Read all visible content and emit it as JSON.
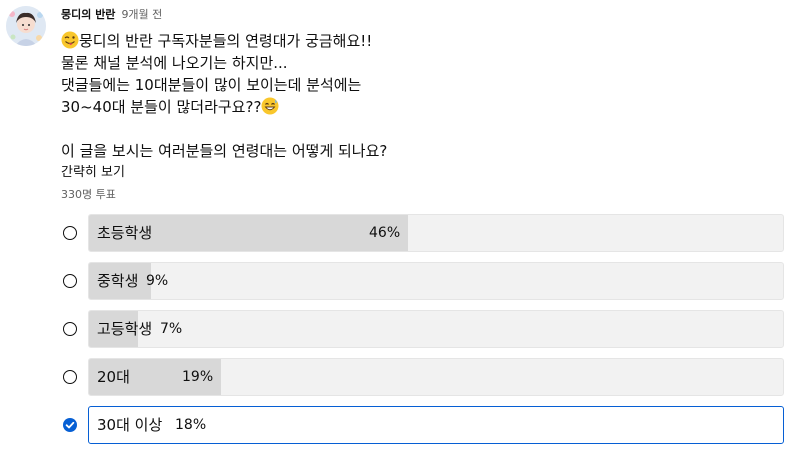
{
  "post": {
    "author": "뭉디의 반란",
    "time": "9개월 전",
    "line1": "뭉디의 반란 구독자분들의 연령대가 궁금해요!!",
    "line2": "물론 채널 분석에 나오기는 하지만...",
    "line3": "댓글들에는 10대분들이 많이 보이는데 분석에는",
    "line4": "30~40대 분들이 많더라구요??",
    "line5": "",
    "line6": "이 글을 보시는 여러분들의 연령대는 어떻게 되나요?",
    "read_more": "간략히 보기",
    "emoji_start": "winking-face-tongue-emoji",
    "emoji_end": "grinning-sweat-emoji"
  },
  "poll": {
    "vote_count": "330명 투표",
    "options": [
      {
        "label": "초등학생",
        "percent_text": "46%",
        "percent": 46,
        "selected": false
      },
      {
        "label": "중학생",
        "percent_text": "9%",
        "percent": 9,
        "selected": false
      },
      {
        "label": "고등학생",
        "percent_text": "7%",
        "percent": 7,
        "selected": false
      },
      {
        "label": "20대",
        "percent_text": "19%",
        "percent": 19,
        "selected": false
      },
      {
        "label": "30대 이상",
        "percent_text": "18%",
        "percent": 18,
        "selected": true
      }
    ]
  },
  "colors": {
    "accent": "#065fd4",
    "bar_fill": "#d8d8d8",
    "option_bg": "#f2f2f2",
    "secondary_text": "#606060"
  }
}
